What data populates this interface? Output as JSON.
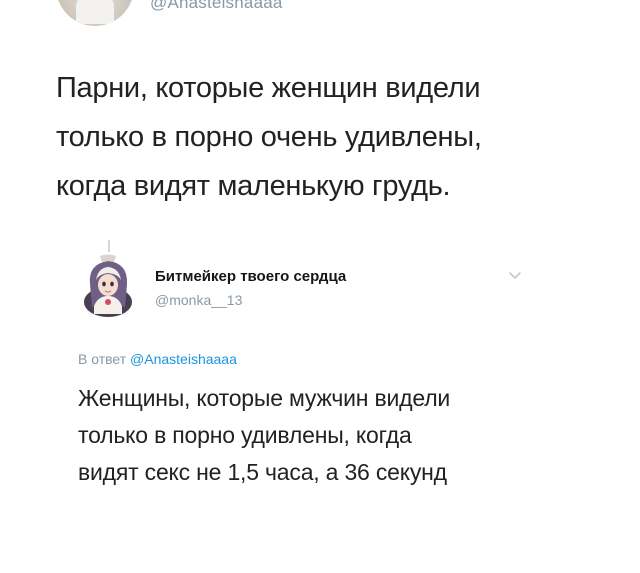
{
  "original_tweet": {
    "handle": "@Anasteishaaaa",
    "text_lines": [
      "Парни, которые женщин видели",
      "только в порно очень удивлены,",
      "когда видят маленькую грудь."
    ]
  },
  "reply_tweet": {
    "author_name": "Битмейкер твоего сердца",
    "handle": "@monka__13",
    "reply_to_prefix": "В ответ",
    "reply_to_mention": "@Anasteishaaaa",
    "text_lines": [
      "Женщины, которые мужчин видели",
      "только в порно удивлены, когда",
      "видят секс не 1,5 часа, а 36 секунд"
    ],
    "icons": {
      "avatar": "anime-avatar-icon",
      "more": "chevron-down-icon"
    }
  },
  "colors": {
    "text": "#222222",
    "secondary": "#8899a6",
    "link": "#1b95e0"
  }
}
